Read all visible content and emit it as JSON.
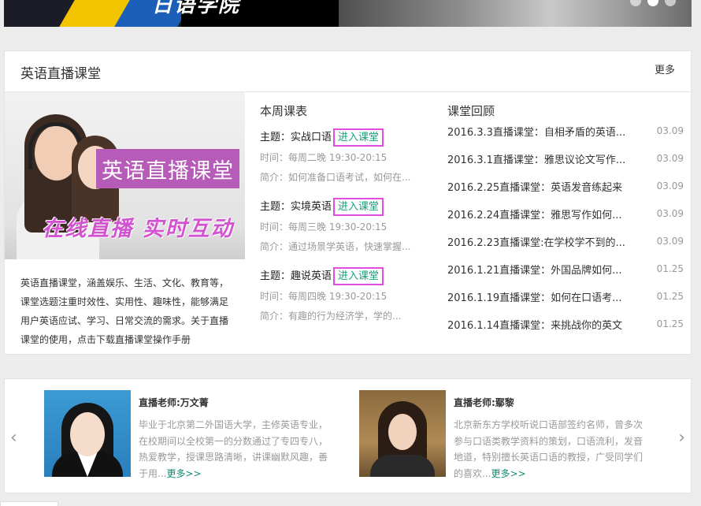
{
  "banner": {
    "text": "日语学院"
  },
  "live_class": {
    "title": "英语直播课堂",
    "more_label": "更多",
    "promo": {
      "headline": "英语直播课堂",
      "tagline": "在线直播  实时互动"
    },
    "description": "英语直播课堂，涵盖娱乐、生活、文化、教育等，课堂选题注重时效性、实用性、趣味性，能够满足用户英语应试、学习、日常交流的需求。关于直播课堂的使用，点击下载直播课堂操作手册",
    "schedule": {
      "title": "本周课表",
      "lessons": [
        {
          "topic": "主题：实战口语",
          "enter": "进入课堂",
          "time": "时间：每周二晚 19:30-20:15",
          "brief": "简介：如何准备口语考试，如何在..."
        },
        {
          "topic": "主题：实境英语",
          "enter": "进入课堂",
          "time": "时间：每周三晚 19:30-20:15",
          "brief": "简介：通过场景学英语，快速掌握..."
        },
        {
          "topic": "主题：趣说英语",
          "enter": "进入课堂",
          "time": "时间：每周四晚 19:30-20:15",
          "brief": "简介：有趣的行为经济学，学的..."
        }
      ]
    },
    "review": {
      "title": "课堂回顾",
      "items": [
        {
          "title": "2016.3.3直播课堂：自相矛盾的英语...",
          "date": "03.09"
        },
        {
          "title": "2016.3.1直播课堂：雅思议论文写作...",
          "date": "03.09"
        },
        {
          "title": "2016.2.25直播课堂：英语发音练起来",
          "date": "03.09"
        },
        {
          "title": "2016.2.24直播课堂：雅思写作如何...",
          "date": "03.09"
        },
        {
          "title": "2016.2.23直播课堂:在学校学不到的...",
          "date": "03.09"
        },
        {
          "title": "2016.1.21直播课堂：外国品牌如何...",
          "date": "01.25"
        },
        {
          "title": "2016.1.19直播课堂：如何在口语考...",
          "date": "01.25"
        },
        {
          "title": "2016.1.14直播课堂：来挑战你的英文",
          "date": "01.25"
        }
      ]
    }
  },
  "teachers": {
    "prev_icon": "chevron-left-icon",
    "next_icon": "chevron-right-icon",
    "items": [
      {
        "name": "直播老师:万文菁",
        "bio": "毕业于北京第二外国语大学，主修英语专业，在校期间以全校第一的分数通过了专四专八，热爱教学，授课思路清晰，讲课幽默风趣，善于用...",
        "more": "更多>>"
      },
      {
        "name": "直播老师:鄢黎",
        "bio": "北京新东方学校听说口语部签约名师，曾多次参与口语类教学资料的策划，口语流利，发音地道，特别擅长英语口语的教授，广受同学们的喜欢...",
        "more": "更多>>"
      }
    ]
  },
  "colors": {
    "accent_green": "#13a37c",
    "highlight_magenta": "#e14de0",
    "promo_purple": "#b65bb7"
  }
}
